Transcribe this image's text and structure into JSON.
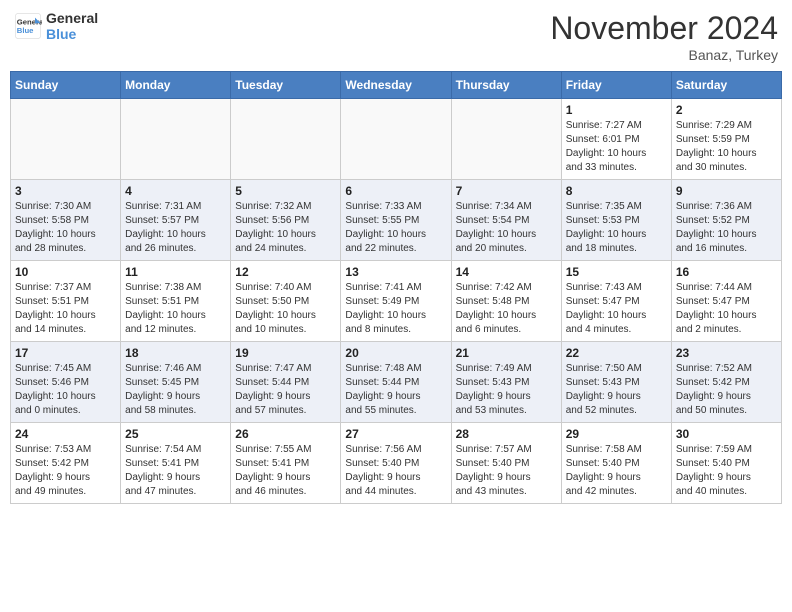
{
  "header": {
    "logo_line1": "General",
    "logo_line2": "Blue",
    "month": "November 2024",
    "location": "Banaz, Turkey"
  },
  "weekdays": [
    "Sunday",
    "Monday",
    "Tuesday",
    "Wednesday",
    "Thursday",
    "Friday",
    "Saturday"
  ],
  "weeks": [
    [
      {
        "day": "",
        "info": ""
      },
      {
        "day": "",
        "info": ""
      },
      {
        "day": "",
        "info": ""
      },
      {
        "day": "",
        "info": ""
      },
      {
        "day": "",
        "info": ""
      },
      {
        "day": "1",
        "info": "Sunrise: 7:27 AM\nSunset: 6:01 PM\nDaylight: 10 hours\nand 33 minutes."
      },
      {
        "day": "2",
        "info": "Sunrise: 7:29 AM\nSunset: 5:59 PM\nDaylight: 10 hours\nand 30 minutes."
      }
    ],
    [
      {
        "day": "3",
        "info": "Sunrise: 7:30 AM\nSunset: 5:58 PM\nDaylight: 10 hours\nand 28 minutes."
      },
      {
        "day": "4",
        "info": "Sunrise: 7:31 AM\nSunset: 5:57 PM\nDaylight: 10 hours\nand 26 minutes."
      },
      {
        "day": "5",
        "info": "Sunrise: 7:32 AM\nSunset: 5:56 PM\nDaylight: 10 hours\nand 24 minutes."
      },
      {
        "day": "6",
        "info": "Sunrise: 7:33 AM\nSunset: 5:55 PM\nDaylight: 10 hours\nand 22 minutes."
      },
      {
        "day": "7",
        "info": "Sunrise: 7:34 AM\nSunset: 5:54 PM\nDaylight: 10 hours\nand 20 minutes."
      },
      {
        "day": "8",
        "info": "Sunrise: 7:35 AM\nSunset: 5:53 PM\nDaylight: 10 hours\nand 18 minutes."
      },
      {
        "day": "9",
        "info": "Sunrise: 7:36 AM\nSunset: 5:52 PM\nDaylight: 10 hours\nand 16 minutes."
      }
    ],
    [
      {
        "day": "10",
        "info": "Sunrise: 7:37 AM\nSunset: 5:51 PM\nDaylight: 10 hours\nand 14 minutes."
      },
      {
        "day": "11",
        "info": "Sunrise: 7:38 AM\nSunset: 5:51 PM\nDaylight: 10 hours\nand 12 minutes."
      },
      {
        "day": "12",
        "info": "Sunrise: 7:40 AM\nSunset: 5:50 PM\nDaylight: 10 hours\nand 10 minutes."
      },
      {
        "day": "13",
        "info": "Sunrise: 7:41 AM\nSunset: 5:49 PM\nDaylight: 10 hours\nand 8 minutes."
      },
      {
        "day": "14",
        "info": "Sunrise: 7:42 AM\nSunset: 5:48 PM\nDaylight: 10 hours\nand 6 minutes."
      },
      {
        "day": "15",
        "info": "Sunrise: 7:43 AM\nSunset: 5:47 PM\nDaylight: 10 hours\nand 4 minutes."
      },
      {
        "day": "16",
        "info": "Sunrise: 7:44 AM\nSunset: 5:47 PM\nDaylight: 10 hours\nand 2 minutes."
      }
    ],
    [
      {
        "day": "17",
        "info": "Sunrise: 7:45 AM\nSunset: 5:46 PM\nDaylight: 10 hours\nand 0 minutes."
      },
      {
        "day": "18",
        "info": "Sunrise: 7:46 AM\nSunset: 5:45 PM\nDaylight: 9 hours\nand 58 minutes."
      },
      {
        "day": "19",
        "info": "Sunrise: 7:47 AM\nSunset: 5:44 PM\nDaylight: 9 hours\nand 57 minutes."
      },
      {
        "day": "20",
        "info": "Sunrise: 7:48 AM\nSunset: 5:44 PM\nDaylight: 9 hours\nand 55 minutes."
      },
      {
        "day": "21",
        "info": "Sunrise: 7:49 AM\nSunset: 5:43 PM\nDaylight: 9 hours\nand 53 minutes."
      },
      {
        "day": "22",
        "info": "Sunrise: 7:50 AM\nSunset: 5:43 PM\nDaylight: 9 hours\nand 52 minutes."
      },
      {
        "day": "23",
        "info": "Sunrise: 7:52 AM\nSunset: 5:42 PM\nDaylight: 9 hours\nand 50 minutes."
      }
    ],
    [
      {
        "day": "24",
        "info": "Sunrise: 7:53 AM\nSunset: 5:42 PM\nDaylight: 9 hours\nand 49 minutes."
      },
      {
        "day": "25",
        "info": "Sunrise: 7:54 AM\nSunset: 5:41 PM\nDaylight: 9 hours\nand 47 minutes."
      },
      {
        "day": "26",
        "info": "Sunrise: 7:55 AM\nSunset: 5:41 PM\nDaylight: 9 hours\nand 46 minutes."
      },
      {
        "day": "27",
        "info": "Sunrise: 7:56 AM\nSunset: 5:40 PM\nDaylight: 9 hours\nand 44 minutes."
      },
      {
        "day": "28",
        "info": "Sunrise: 7:57 AM\nSunset: 5:40 PM\nDaylight: 9 hours\nand 43 minutes."
      },
      {
        "day": "29",
        "info": "Sunrise: 7:58 AM\nSunset: 5:40 PM\nDaylight: 9 hours\nand 42 minutes."
      },
      {
        "day": "30",
        "info": "Sunrise: 7:59 AM\nSunset: 5:40 PM\nDaylight: 9 hours\nand 40 minutes."
      }
    ]
  ]
}
